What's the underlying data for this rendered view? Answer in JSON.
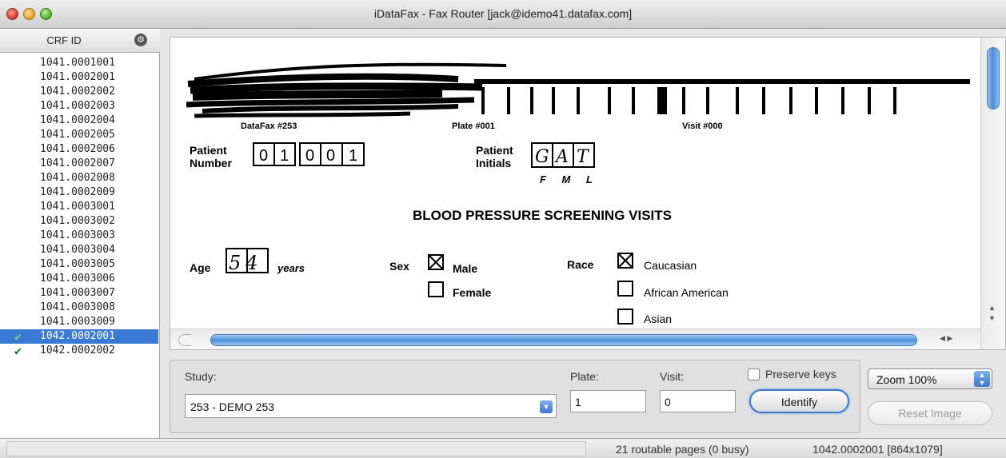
{
  "window": {
    "title": "iDataFax - Fax Router [jack@idemo41.datafax.com]"
  },
  "crf_panel": {
    "column_header": "CRF ID",
    "items": [
      {
        "id": "1041.0001001",
        "selected": false,
        "mark": ""
      },
      {
        "id": "1041.0002001",
        "selected": false,
        "mark": ""
      },
      {
        "id": "1041.0002002",
        "selected": false,
        "mark": ""
      },
      {
        "id": "1041.0002003",
        "selected": false,
        "mark": ""
      },
      {
        "id": "1041.0002004",
        "selected": false,
        "mark": ""
      },
      {
        "id": "1041.0002005",
        "selected": false,
        "mark": ""
      },
      {
        "id": "1041.0002006",
        "selected": false,
        "mark": ""
      },
      {
        "id": "1041.0002007",
        "selected": false,
        "mark": ""
      },
      {
        "id": "1041.0002008",
        "selected": false,
        "mark": ""
      },
      {
        "id": "1041.0002009",
        "selected": false,
        "mark": ""
      },
      {
        "id": "1041.0003001",
        "selected": false,
        "mark": ""
      },
      {
        "id": "1041.0003002",
        "selected": false,
        "mark": ""
      },
      {
        "id": "1041.0003003",
        "selected": false,
        "mark": ""
      },
      {
        "id": "1041.0003004",
        "selected": false,
        "mark": ""
      },
      {
        "id": "1041.0003005",
        "selected": false,
        "mark": ""
      },
      {
        "id": "1041.0003006",
        "selected": false,
        "mark": ""
      },
      {
        "id": "1041.0003007",
        "selected": false,
        "mark": ""
      },
      {
        "id": "1041.0003008",
        "selected": false,
        "mark": ""
      },
      {
        "id": "1041.0003009",
        "selected": false,
        "mark": ""
      },
      {
        "id": "1042.0002001",
        "selected": true,
        "mark": "✔"
      },
      {
        "id": "1042.0002002",
        "selected": false,
        "mark": "✔"
      }
    ]
  },
  "fax_image": {
    "barcode_labels": [
      "DataFax #253",
      "Plate #001",
      "Visit #000"
    ],
    "patient_number_label": "Patient Number",
    "patient_number_digits": [
      "0",
      "1",
      "0",
      "0",
      "1"
    ],
    "patient_initials_label": "Patient Initials",
    "patient_initials": [
      "G",
      "A",
      "T"
    ],
    "initials_legend": "F M L",
    "form_title": "BLOOD PRESSURE SCREENING VISITS",
    "age_label": "Age",
    "age_value": "54",
    "age_unit": "years",
    "sex_label": "Sex",
    "sex_options": [
      {
        "label": "Male",
        "checked": true
      },
      {
        "label": "Female",
        "checked": false
      }
    ],
    "race_label": "Race",
    "race_options": [
      {
        "label": "Caucasian",
        "checked": true
      },
      {
        "label": "African American",
        "checked": false
      },
      {
        "label": "Asian",
        "checked": false
      }
    ]
  },
  "controls": {
    "study_label": "Study:",
    "study_value": "253 - DEMO 253",
    "plate_label": "Plate:",
    "plate_value": "1",
    "visit_label": "Visit:",
    "visit_value": "0",
    "preserve_keys_label": "Preserve keys",
    "preserve_keys_checked": false,
    "identify_label": "Identify",
    "zoom_value": "Zoom 100%",
    "reset_label": "Reset Image"
  },
  "status": {
    "routable_text": "21 routable pages (0 busy)",
    "page_info": "1042.0002001 [864x1079]"
  },
  "icons": {
    "options_icon": "gear-icon",
    "checkmark_icon": "checkmark-icon"
  },
  "colors": {
    "selection": "#3a79d4",
    "accent": "#3a78cc"
  }
}
